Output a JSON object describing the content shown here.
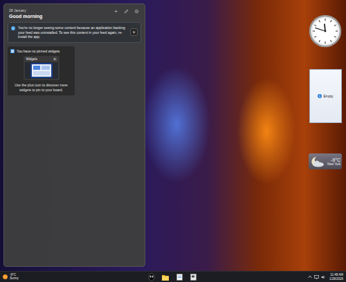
{
  "widgets_panel": {
    "date": "28 January",
    "greeting": "Good morning",
    "add_button": "+",
    "notice": {
      "text": "You're no longer seeing some content because an application backing your feed was uninstalled. To see this content in your feed again, re-install the app.",
      "close": "×"
    },
    "pinned_card": {
      "title": "You have no pinned widgets",
      "preview_label": "Widgets",
      "preview_add": "+",
      "hint": "Use the plus icon to discover more widgets to pin to your board."
    }
  },
  "gadgets": {
    "clock": {
      "hours": 11,
      "minutes": 48
    },
    "notes": {
      "text": "Empty"
    },
    "weather": {
      "temperature": "-9°C",
      "city": "New York"
    }
  },
  "taskbar": {
    "weather": {
      "temperature": "-9°C",
      "condition": "Sunny"
    },
    "clock": {
      "time": "11:48 AM",
      "date": "1/28/2026"
    }
  }
}
